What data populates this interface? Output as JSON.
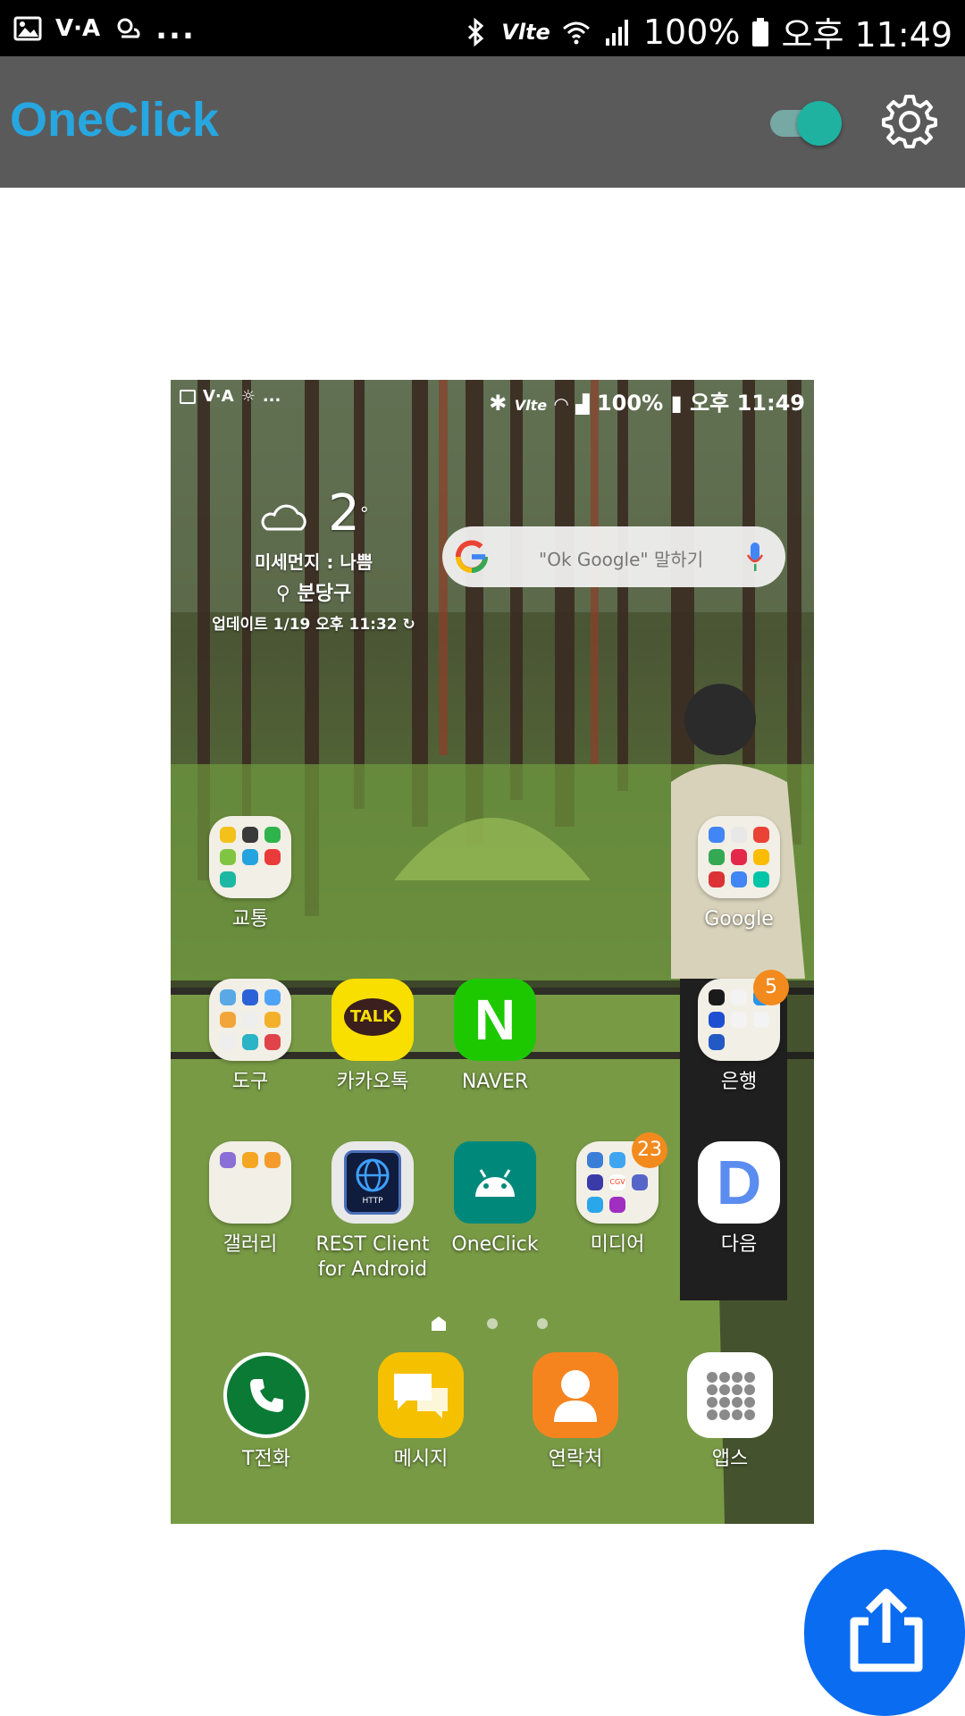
{
  "status_bar": {
    "left_text": "V·A",
    "dots": "...",
    "network": "Vlte",
    "battery": "100%",
    "time": "오후 11:49"
  },
  "app_bar": {
    "title": "OneClick",
    "toggle_on": true,
    "accent": "#27a7e0"
  },
  "preview": {
    "status_bar": {
      "left_text": "V·A",
      "dots": "...",
      "network": "Vlte",
      "battery": "100%",
      "time": "오후 11:49"
    },
    "weather": {
      "temp": "2",
      "degree": "°",
      "dust": "미세먼지 : 나쁨",
      "location": "분당구",
      "updated": "업데이트 1/19 오후 11:32"
    },
    "search": {
      "placeholder": "\"Ok Google\" 말하기"
    },
    "apps": [
      {
        "label": "교통",
        "type": "folder"
      },
      {
        "label": "Google",
        "type": "folder"
      },
      {
        "label": "도구",
        "type": "folder"
      },
      {
        "label": "카카오톡",
        "type": "app",
        "icon_text": "TALK"
      },
      {
        "label": "NAVER",
        "type": "app",
        "icon_text": "N"
      },
      {
        "label": "은행",
        "type": "folder",
        "badge": "5"
      },
      {
        "label": "갤러리",
        "type": "folder"
      },
      {
        "label": "REST Client\nfor Android",
        "label_line1": "REST Client",
        "label_line2": "for Android",
        "type": "app",
        "icon_text": "HTTP"
      },
      {
        "label": "OneClick",
        "type": "app"
      },
      {
        "label": "미디어",
        "type": "folder",
        "badge": "23",
        "icon_text": "CGV"
      },
      {
        "label": "다음",
        "type": "app",
        "icon_text": "D"
      }
    ],
    "dock": [
      {
        "label": "T전화"
      },
      {
        "label": "메시지"
      },
      {
        "label": "연락처"
      },
      {
        "label": "앱스"
      }
    ]
  }
}
